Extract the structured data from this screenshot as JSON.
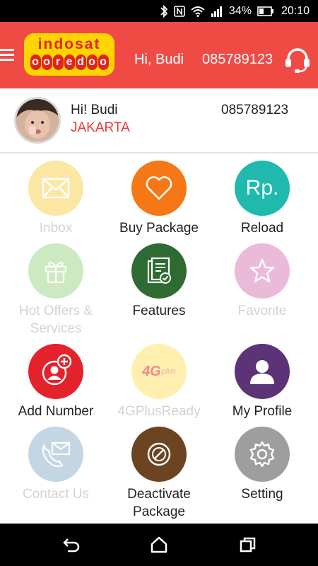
{
  "status_bar": {
    "battery": "34%",
    "time": "20:10",
    "icons": [
      "bluetooth-icon",
      "nfc-icon",
      "wifi-icon",
      "signal-icon",
      "battery-icon"
    ]
  },
  "header": {
    "logo_line1": "indosat",
    "logo_line2": [
      "o",
      "o",
      "r",
      "e",
      "d",
      "o",
      "o"
    ],
    "greeting": "Hi, Budi",
    "phone": "085789123",
    "brand_color": "#ef4b44"
  },
  "profile": {
    "name": "Hi! Budi",
    "city": "JAKARTA",
    "phone": "085789123"
  },
  "menu": {
    "inbox": "Inbox",
    "buy_package": "Buy Package",
    "reload": "Reload",
    "reload_icon_text": "Rp.",
    "hot_offers": "Hot Offers & Services",
    "features": "Features",
    "favorite": "Favorite",
    "add_number": "Add Number",
    "four_g_plus": "4GPlusReady",
    "four_g_badge": "4G",
    "four_g_badge_small": "plus",
    "my_profile": "My Profile",
    "contact_us": "Contact Us",
    "deactivate": "Deactivate Package",
    "setting": "Setting",
    "colors": {
      "inbox": "#fce6a4",
      "buy_package": "#f57716",
      "reload": "#1fb9ad",
      "hot_offers": "#cce9c1",
      "features": "#2e6b32",
      "favorite": "#ebbad8",
      "add_number": "#e4222b",
      "four_g_plus": "#fff0b0",
      "my_profile": "#5c3377",
      "contact_us": "#c4d6e4",
      "deactivate": "#6d4421",
      "setting": "#9e9e9e"
    }
  }
}
